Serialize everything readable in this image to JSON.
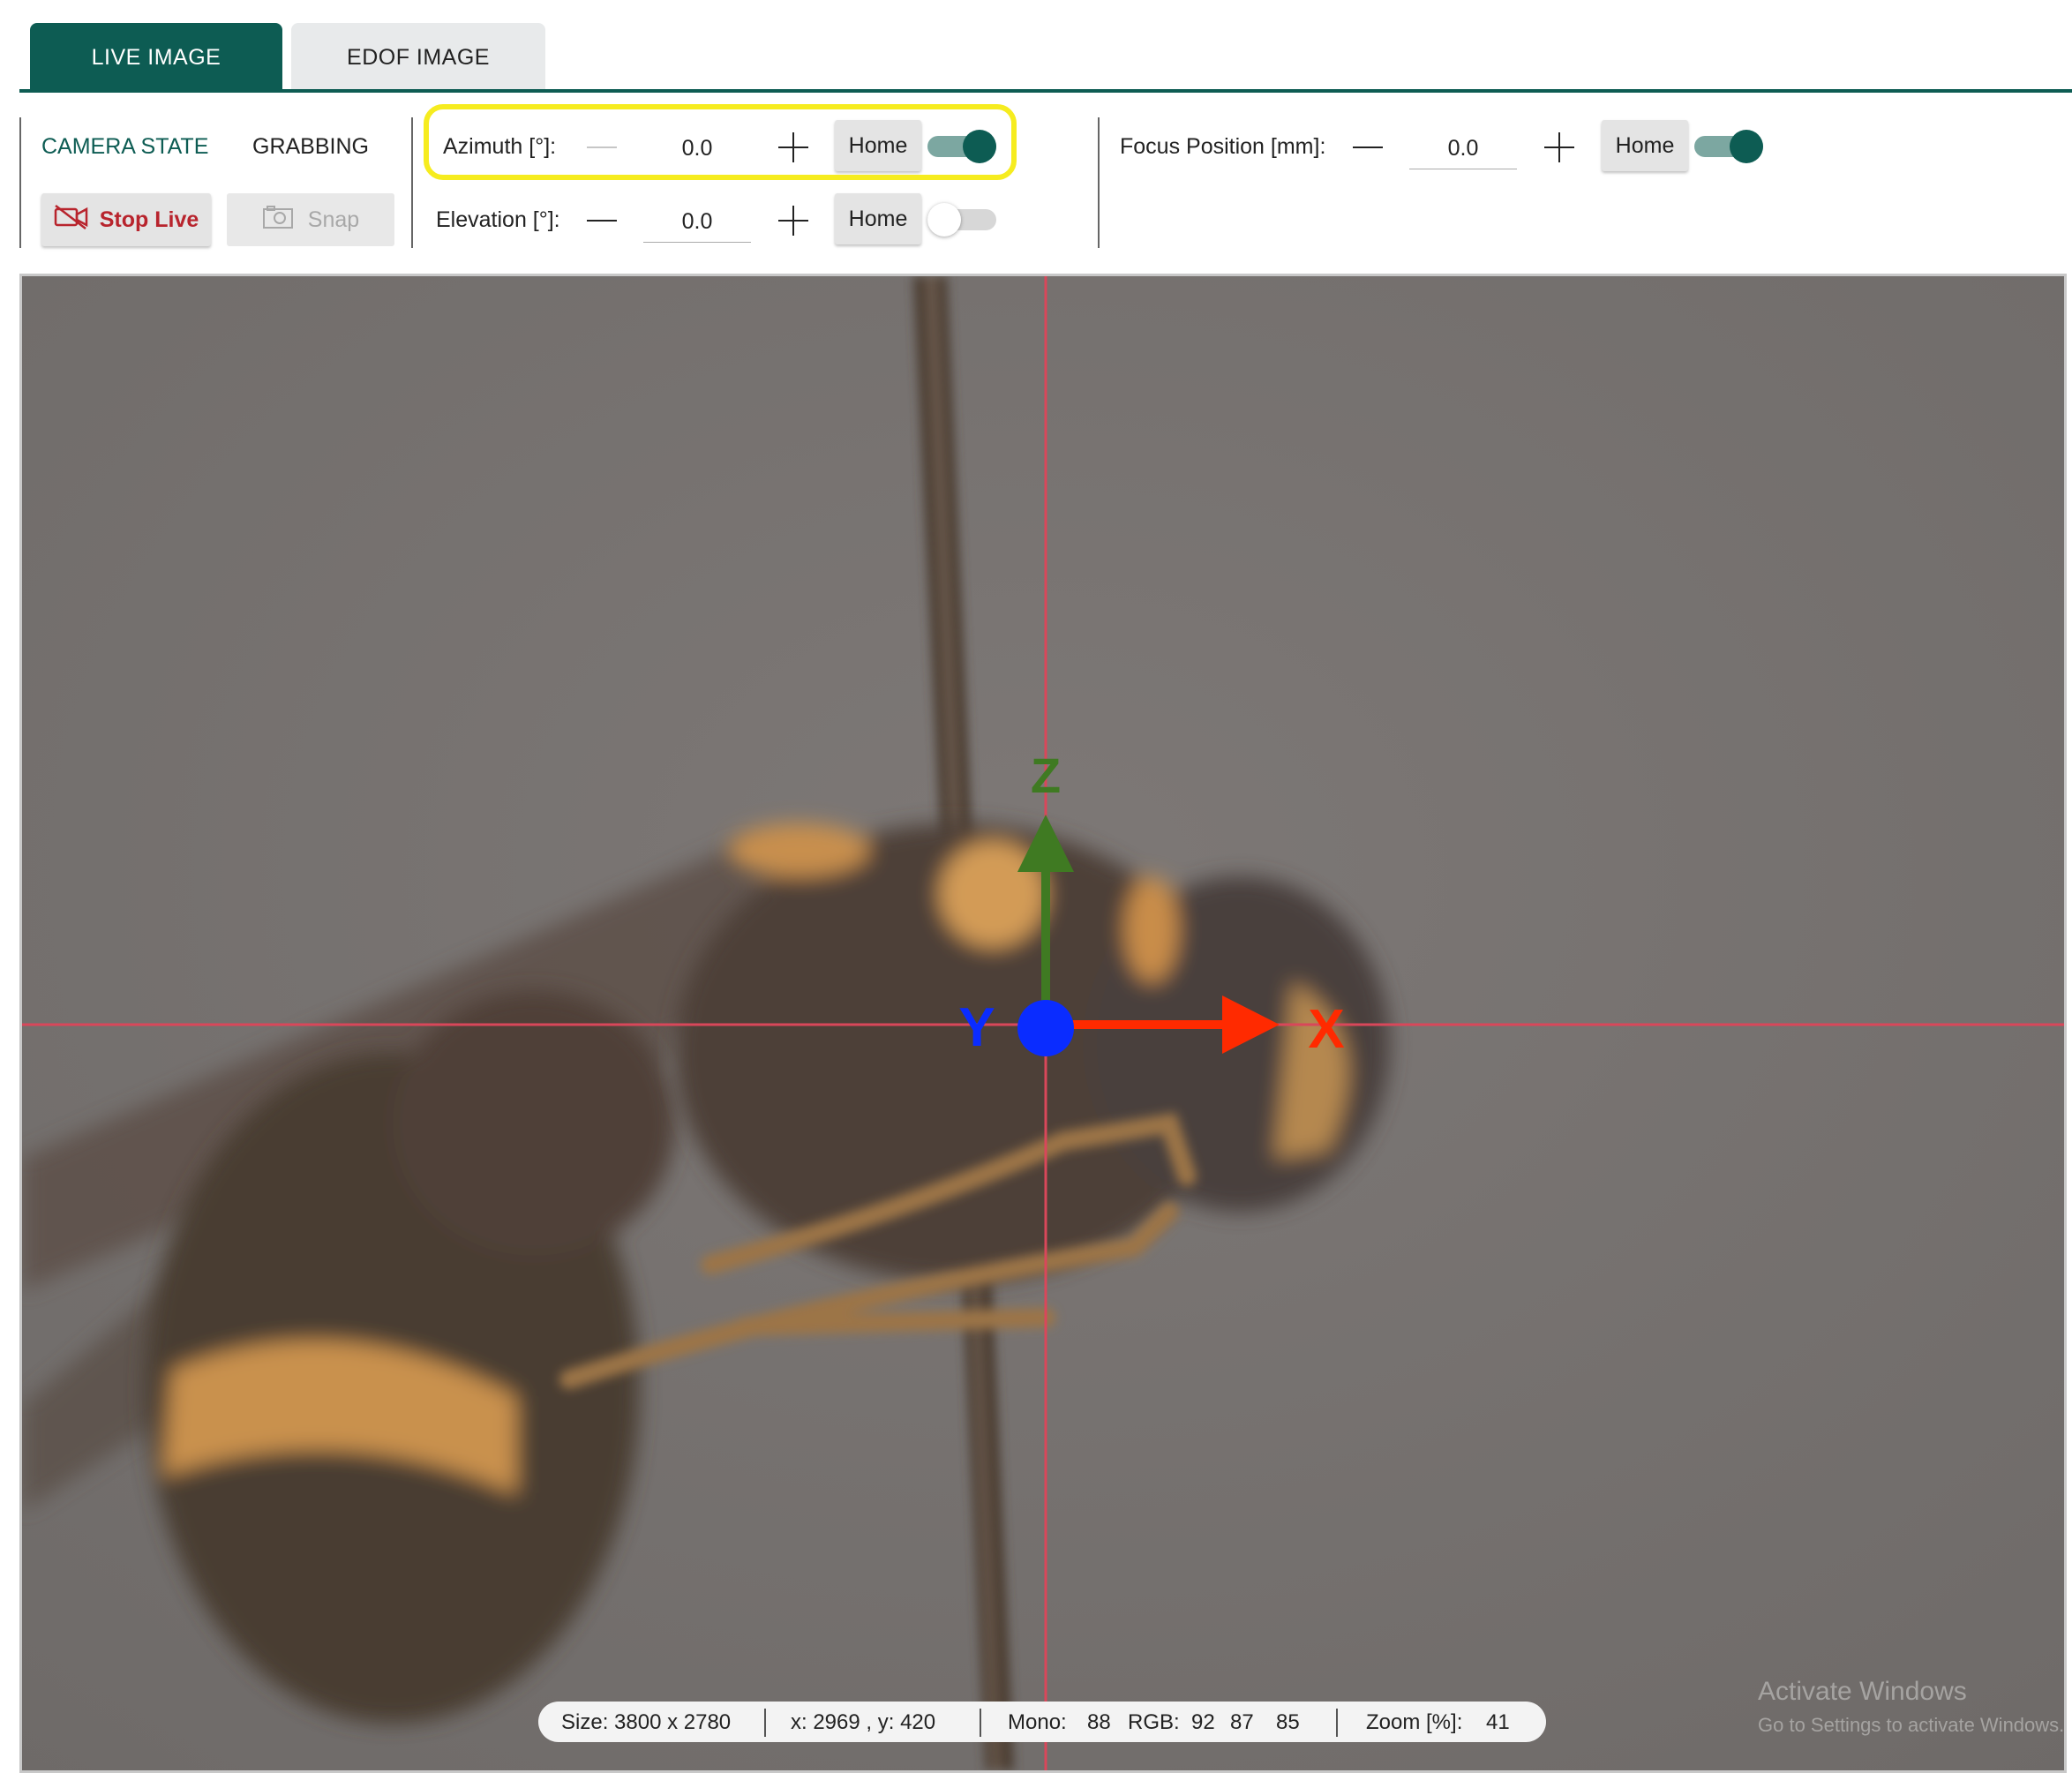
{
  "tabs": [
    {
      "label": "LIVE IMAGE",
      "active": true
    },
    {
      "label": "EDOF IMAGE",
      "active": false
    }
  ],
  "camera": {
    "state_label": "CAMERA STATE",
    "state_value": "GRABBING",
    "stop_live_label": "Stop Live",
    "snap_label": "Snap"
  },
  "azimuth": {
    "label": "Azimuth [°]:",
    "value": "0.0",
    "home_label": "Home",
    "enabled": true
  },
  "elevation": {
    "label": "Elevation [°]:",
    "value": "0.0",
    "home_label": "Home",
    "enabled": false
  },
  "focus": {
    "label": "Focus Position [mm]:",
    "value": "0.0",
    "home_label": "Home",
    "enabled": true
  },
  "axes": {
    "x": "X",
    "y": "Y",
    "z": "Z"
  },
  "status": {
    "size": "Size: 3800 x 2780",
    "position": "x: 2969 , y:  420",
    "mono_label": "Mono:",
    "mono_value": "88",
    "rgb_label": "RGB:",
    "rgb_r": "92",
    "rgb_g": "87",
    "rgb_b": "85",
    "zoom_label": "Zoom [%]:",
    "zoom_value": "41"
  },
  "watermark": {
    "title": "Activate Windows",
    "subtitle": "Go to Settings to activate Windows."
  },
  "colors": {
    "accent": "#0d5c53",
    "highlight": "#f6ec1f",
    "stop": "#b8242d",
    "crosshair": "#d9475a",
    "x_axis": "#ff2a00",
    "y_axis": "#0a2cff",
    "z_axis": "#3f7a22"
  },
  "icons": {
    "stop_live": "video-off-icon",
    "snap": "camera-icon",
    "decrement": "minus-icon",
    "increment": "plus-icon"
  }
}
